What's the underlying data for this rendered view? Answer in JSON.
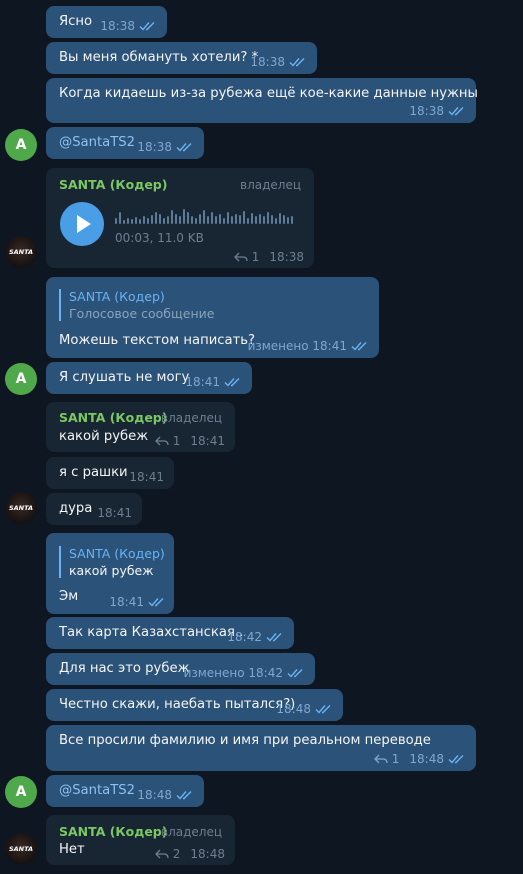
{
  "avatars": {
    "a_letter": "A",
    "santa_label": "SANTA"
  },
  "messages": [
    {
      "text": "Ясно",
      "time": "18:38"
    },
    {
      "text": "Вы меня обмануть хотели? *",
      "time": "18:38"
    },
    {
      "text": "Когда кидаешь из-за рубежа ещё кое-какие данные нужны",
      "time": "18:38"
    },
    {
      "text": "@SantaTS2",
      "time": "18:38"
    },
    {
      "sender": "SANTA (Кодер)",
      "role": "владелец",
      "duration": "00:03, 11.0 KB",
      "replies": "1",
      "time": "18:38"
    },
    {
      "reply_name": "SANTA (Кодер)",
      "reply_text": "Голосовое сообщение",
      "text": "Можешь текстом написать?",
      "time": "изменено 18:41"
    },
    {
      "text": "Я слушать не могу",
      "time": "18:41"
    },
    {
      "sender": "SANTA (Кодер)",
      "role": "владелец",
      "text": "какой рубеж",
      "replies": "1",
      "time": "18:41"
    },
    {
      "text": "я с рашки",
      "time": "18:41"
    },
    {
      "text": "дура",
      "time": "18:41"
    },
    {
      "reply_name": "SANTA (Кодер)",
      "reply_text": "какой рубеж",
      "text": "Эм",
      "time": "18:41"
    },
    {
      "text": "Так карта Казахстанская..",
      "time": "18:42"
    },
    {
      "text": "Для нас это рубеж",
      "time": "изменено 18:42"
    },
    {
      "text": "Честно скажи, наебать пытался?)",
      "time": "18:48"
    },
    {
      "text": "Все просили фамилию и имя при реальном переводе",
      "replies": "1",
      "time": "18:48"
    },
    {
      "text": "@SantaTS2",
      "time": "18:48"
    },
    {
      "sender": "SANTA (Кодер)",
      "role": "владелец",
      "text": "Нет",
      "replies": "2",
      "time": "18:48"
    }
  ],
  "colors": {
    "background": "#0e1621",
    "outgoing": "#2b5278",
    "incoming": "#182533",
    "accent": "#6ab3f3",
    "sender": "#7bc862"
  }
}
